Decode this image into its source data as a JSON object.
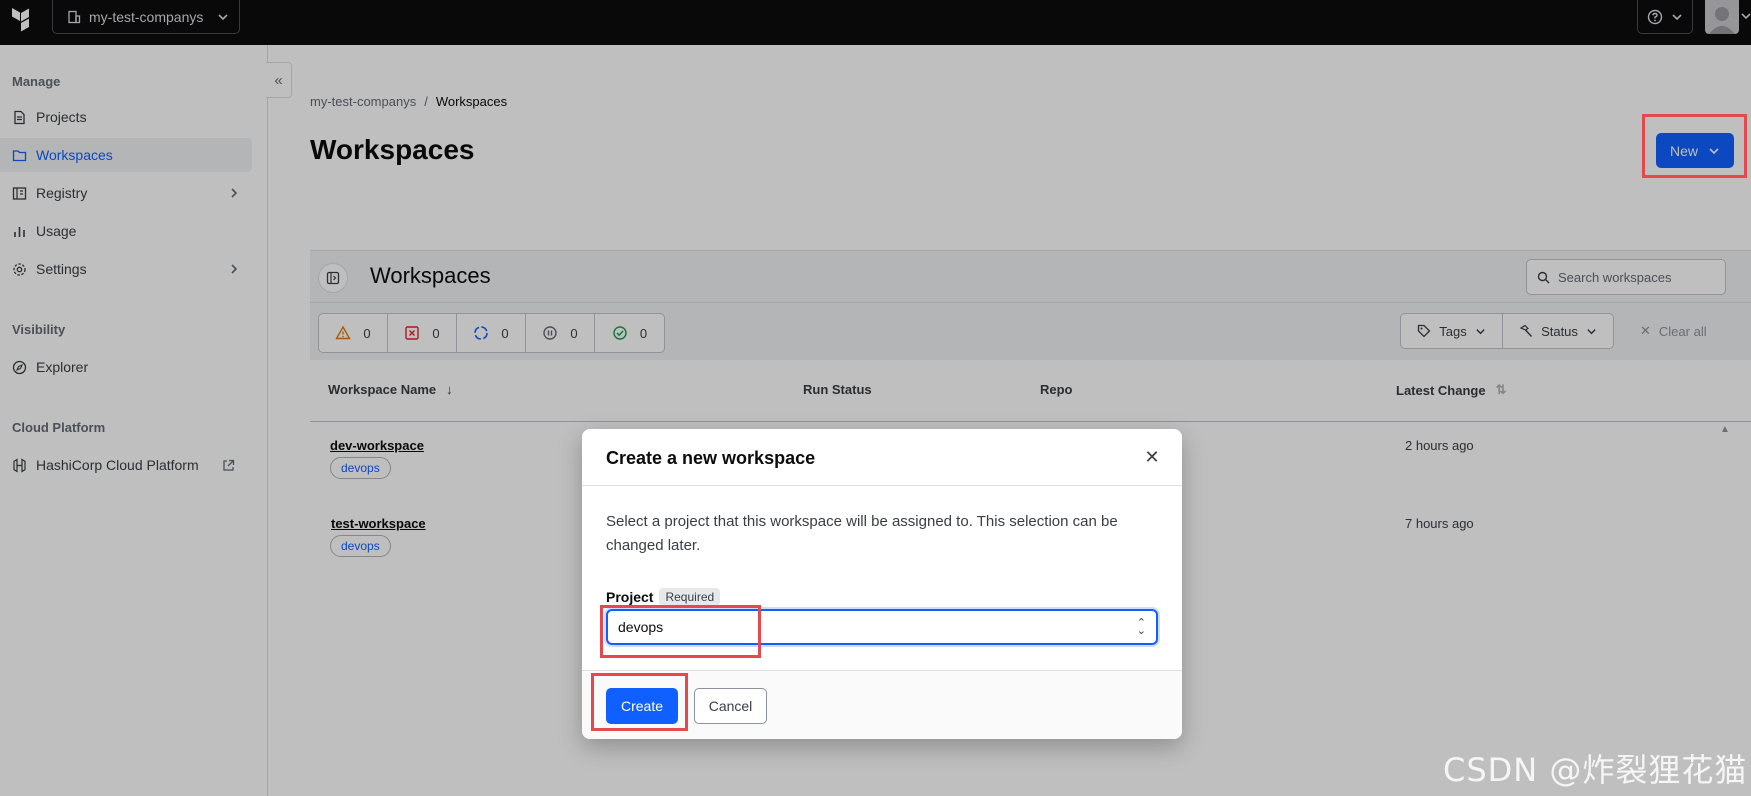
{
  "topbar": {
    "org_name": "my-test-companys"
  },
  "sidebar": {
    "sections": {
      "manage": "Manage",
      "visibility": "Visibility",
      "cloud": "Cloud Platform"
    },
    "items": [
      {
        "label": "Projects"
      },
      {
        "label": "Workspaces"
      },
      {
        "label": "Registry"
      },
      {
        "label": "Usage"
      },
      {
        "label": "Settings"
      },
      {
        "label": "Explorer"
      },
      {
        "label": "HashiCorp Cloud Platform"
      }
    ]
  },
  "breadcrumb": {
    "org": "my-test-companys",
    "sep": "/",
    "current": "Workspaces"
  },
  "page": {
    "title": "Workspaces",
    "new_label": "New"
  },
  "panel": {
    "title": "Workspaces",
    "search_placeholder": "Search workspaces",
    "status_counts": [
      "0",
      "0",
      "0",
      "0",
      "0"
    ],
    "tags_label": "Tags",
    "status_label": "Status",
    "clear_label": "Clear all"
  },
  "table": {
    "headers": {
      "name": "Workspace Name",
      "run_status": "Run Status",
      "repo": "Repo",
      "latest_change": "Latest Change"
    },
    "rows": [
      {
        "name": "dev-workspace",
        "tag": "devops",
        "latest_change": "2 hours ago"
      },
      {
        "name": "test-workspace",
        "tag": "devops",
        "latest_change": "7 hours ago"
      }
    ]
  },
  "modal": {
    "title": "Create a new workspace",
    "description": "Select a project that this workspace will be assigned to. This selection can be changed later.",
    "field_label": "Project",
    "required_badge": "Required",
    "selected_project": "devops",
    "create_label": "Create",
    "cancel_label": "Cancel"
  },
  "watermark": "CSDN @炸裂狸花猫",
  "colors": {
    "accent": "#1060ff",
    "highlight": "#e5484d",
    "topbar": "#0c0c0e"
  }
}
